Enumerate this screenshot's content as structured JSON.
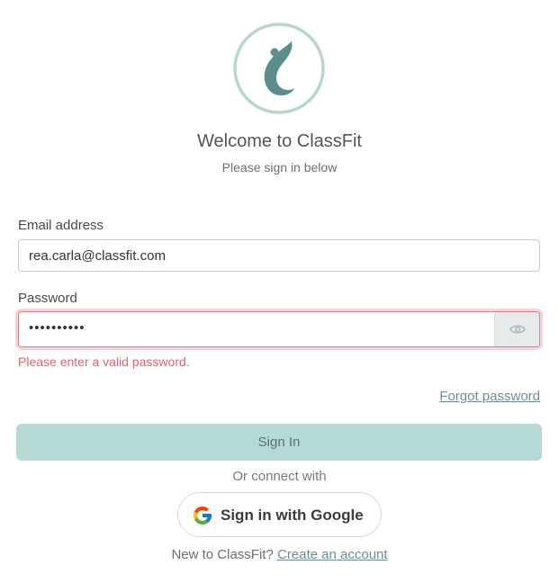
{
  "app": {
    "title": "Welcome to ClassFit",
    "subtitle": "Please sign in below"
  },
  "colors": {
    "brand": "#5c8d8d",
    "logo_ring": "#b7d6d2",
    "button_bg": "#b5d9d5",
    "error": "#d9686f",
    "link": "#6f8d92"
  },
  "form": {
    "email": {
      "label": "Email address",
      "value": "rea.carla@classfit.com"
    },
    "password": {
      "label": "Password",
      "value": "••••••••••",
      "toggle_icon": "eye-icon",
      "error": "Please enter a valid password."
    },
    "forgot_label": "Forgot password",
    "signin_label": "Sign In"
  },
  "social": {
    "divider": "Or connect with",
    "google_label": "Sign in with Google",
    "google_icon": "google-g-icon"
  },
  "footer": {
    "prompt": "New to ClassFit?",
    "link": "Create an account"
  }
}
